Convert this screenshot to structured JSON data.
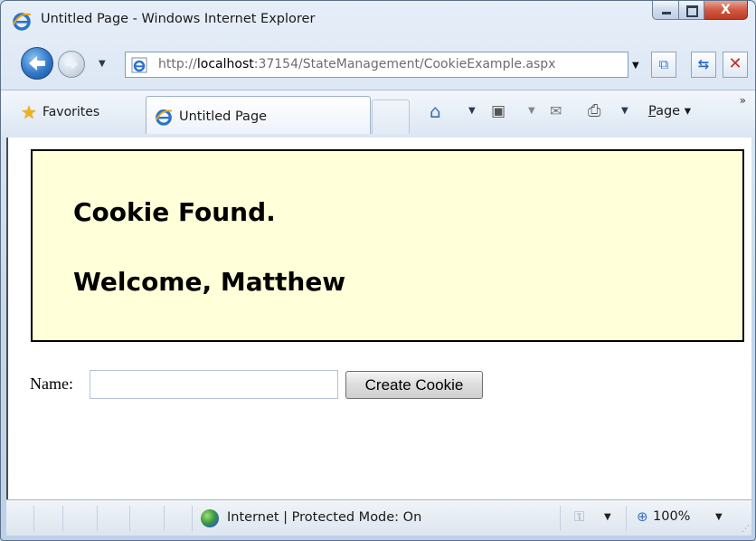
{
  "window": {
    "title": "Untitled Page - Windows Internet Explorer",
    "caption_buttons": {
      "minimize_icon": "minimize-icon",
      "maximize_icon": "maximize-icon",
      "close_glyph": "X"
    }
  },
  "nav": {
    "address": {
      "prefix": "http://",
      "host": "localhost",
      "rest": ":37154/StateManagement/CookieExample.aspx"
    },
    "dropdown_glyph": "▼"
  },
  "toolbar": {
    "favorites_label": "Favorites",
    "tab_label": "Untitled Page",
    "page_menu_letter": "P",
    "page_menu_rest": "age ▾",
    "more_glyph": "»"
  },
  "content": {
    "message_line1": "Cookie Found.",
    "message_line2": "Welcome, Matthew",
    "panel_background": "#ffffd9",
    "form": {
      "name_label": "Name:",
      "name_value": "",
      "button_label": "Create Cookie"
    }
  },
  "status": {
    "zone_text": "Internet | Protected Mode: On",
    "zoom_text": "100%"
  }
}
